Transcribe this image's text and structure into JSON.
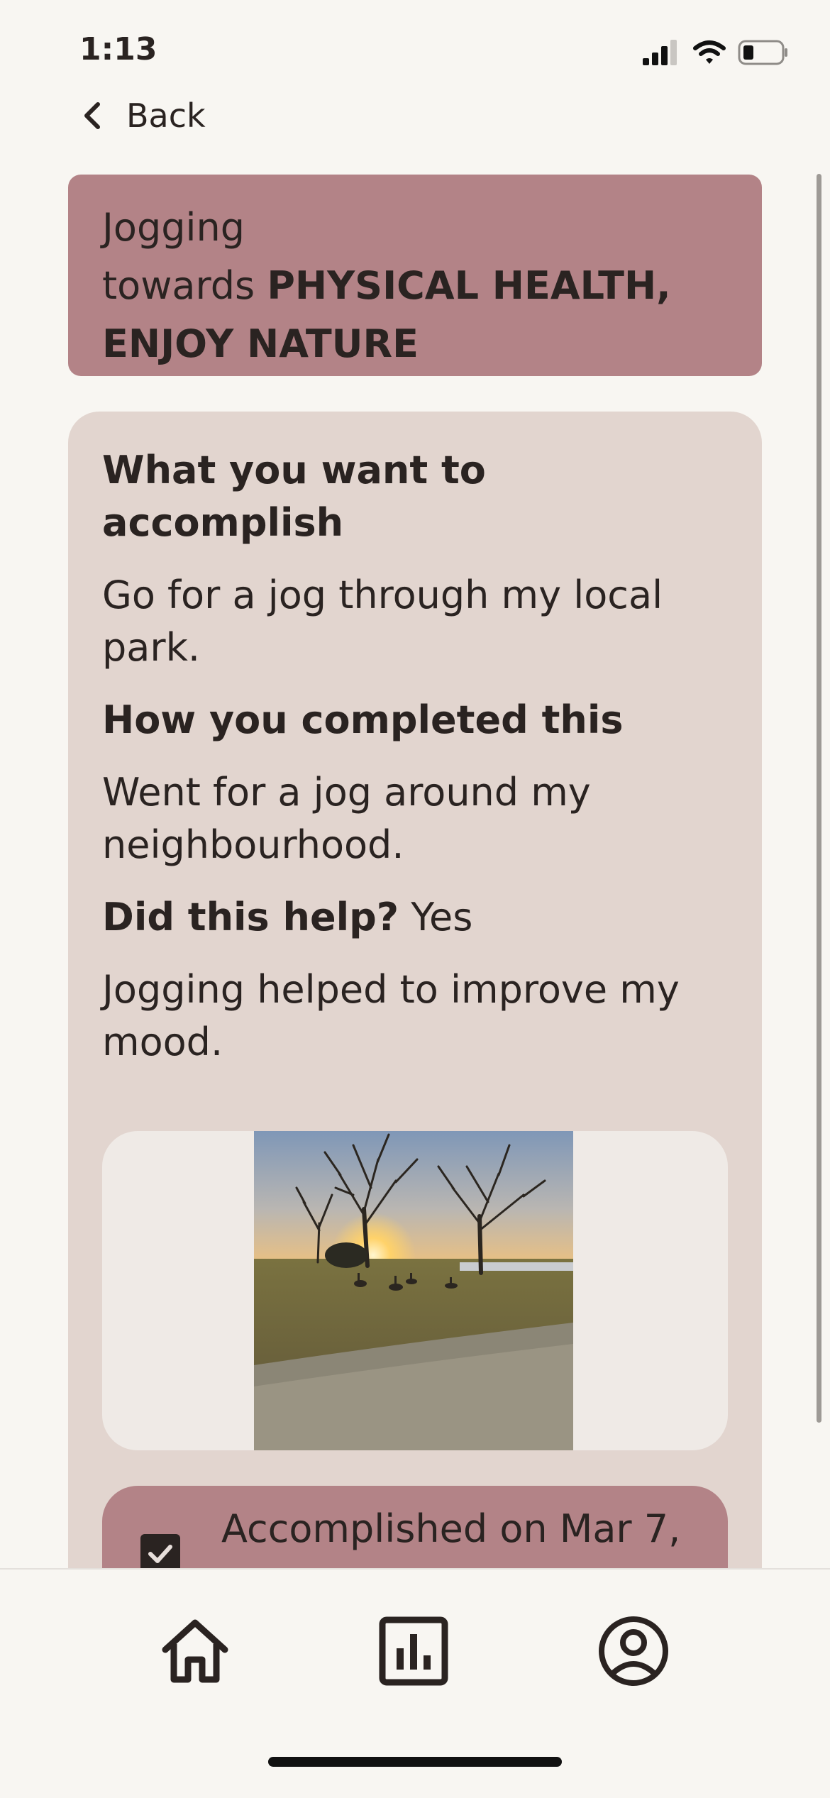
{
  "status_bar": {
    "time": "1:13",
    "icons": [
      "cellular-signal-icon",
      "wifi-icon",
      "battery-icon"
    ]
  },
  "nav": {
    "back_label": "Back",
    "back_icon": "chevron-left-icon"
  },
  "goal": {
    "activity": "Jogging",
    "towards_label": "towards",
    "values": "PHYSICAL HEALTH, ENJOY NATURE",
    "banner_color": "#b38387"
  },
  "details": {
    "accomplish_heading": "What you want to accomplish",
    "accomplish_text": "Go for a jog through my local park.",
    "completed_heading": "How you completed this",
    "completed_text": "Went for a jog around my neighbourhood.",
    "helped_heading": "Did this help?",
    "helped_answer": "Yes",
    "helped_text": "Jogging helped to improve my mood.",
    "card_color": "#e2d5cf"
  },
  "accomplished": {
    "checked": true,
    "label": "Accomplished on Mar 7,"
  },
  "tab_bar": {
    "tabs": [
      "home-icon",
      "stats-icon",
      "profile-icon"
    ]
  }
}
